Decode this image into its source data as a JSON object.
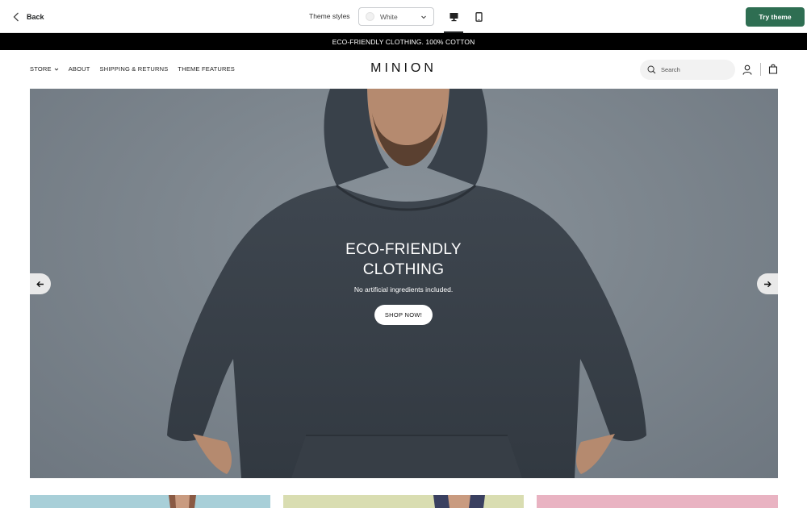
{
  "editor": {
    "back_label": "Back",
    "styles_label": "Theme styles",
    "style_value": "White",
    "try_label": "Try theme",
    "accent_color": "#2e6e52"
  },
  "announcement": {
    "text": "ECO-FRIENDLY CLOTHING. 100% COTTON"
  },
  "store": {
    "nav": [
      "STORE",
      "ABOUT",
      "SHIPPING & RETURNS",
      "THEME FEATURES"
    ],
    "logo": "MINION",
    "search_placeholder": "Search",
    "icons": [
      "search-icon",
      "account-icon",
      "cart-icon"
    ]
  },
  "hero": {
    "title": "ECO-FRIENDLY CLOTHING",
    "subtitle": "No artificial ingredients included.",
    "button": "SHOP NOW!"
  },
  "cards": [
    {
      "color": "#a8cfd8"
    },
    {
      "color": "#d9ddb1"
    },
    {
      "color": "#e9b3c2"
    }
  ]
}
